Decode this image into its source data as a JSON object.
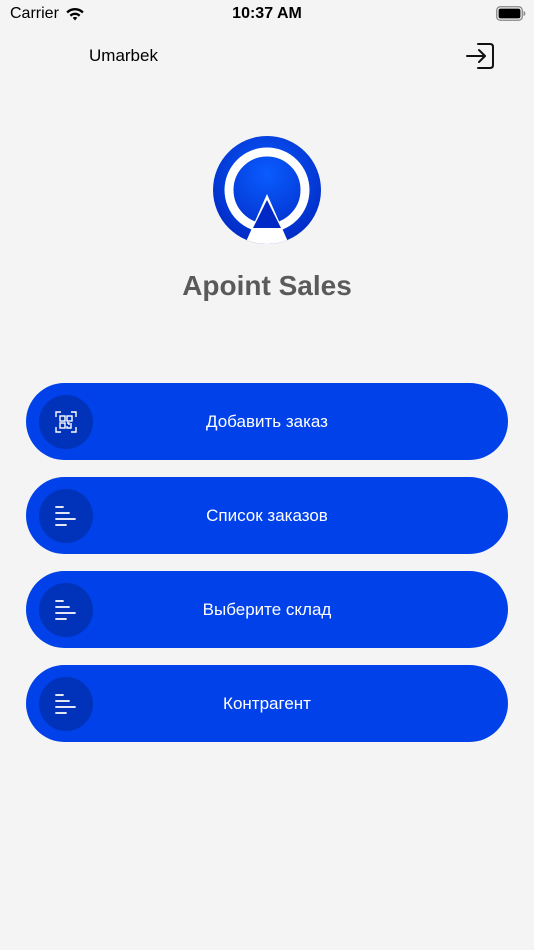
{
  "status_bar": {
    "carrier": "Carrier",
    "time": "10:37 AM"
  },
  "header": {
    "username": "Umarbek",
    "logout_icon": "logout-icon"
  },
  "app": {
    "title": "Apoint Sales",
    "logo_icon": "apoint-logo"
  },
  "colors": {
    "background": "#f4f4f4",
    "button": "#0041ea",
    "button_icon_bg": "#0033b9",
    "title": "#5a5a5a",
    "logo_outer": "#0045e6",
    "logo_inner": "#0024b8"
  },
  "menu": {
    "items": [
      {
        "label": "Добавить заказ",
        "icon": "qr-scan-icon"
      },
      {
        "label": "Список заказов",
        "icon": "list-icon"
      },
      {
        "label": "Выберите склад",
        "icon": "list-icon"
      },
      {
        "label": "Контрагент",
        "icon": "list-icon"
      }
    ]
  }
}
